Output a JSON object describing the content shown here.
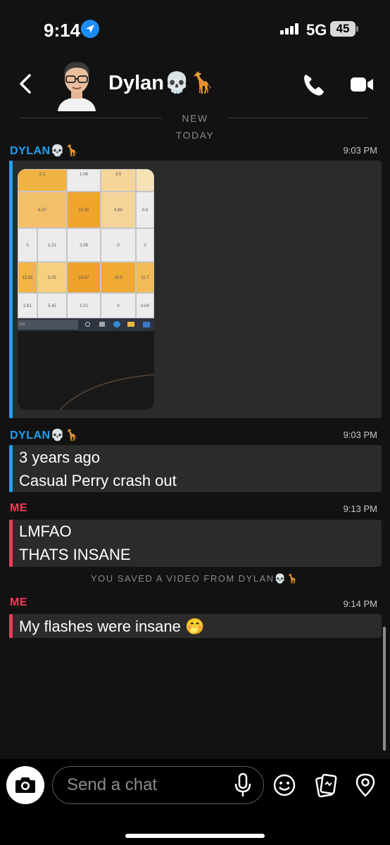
{
  "status_bar": {
    "time": "9:14",
    "network": "5G",
    "battery": "45"
  },
  "header": {
    "contact_name": "Dylan💀🦒"
  },
  "dividers": {
    "new_label": "NEW",
    "today_label": "TODAY"
  },
  "messages": [
    {
      "sender": "DYLAN💀🦒",
      "time": "9:03 PM",
      "type": "photo"
    },
    {
      "sender": "DYLAN💀🦒",
      "time": "9:03 PM",
      "lines": [
        "3 years ago",
        "Casual Perry crash out"
      ]
    },
    {
      "sender": "ME",
      "time": "9:13 PM",
      "lines": [
        "LMFAO",
        "THATS INSANE"
      ]
    },
    {
      "sender": "ME",
      "time": "9:14 PM",
      "lines": [
        "My flashes were insane 🤭"
      ]
    }
  ],
  "system_notice": "YOU SAVED A VIDEO FROM DYLAN💀🦒",
  "photo_sheet": {
    "rows": [
      [
        "5.2",
        "1.08",
        "3.5"
      ],
      [
        "6.37",
        "10.55",
        "4.86",
        "0.6"
      ],
      [
        "0",
        "1.21",
        "2.08",
        "0",
        "0"
      ],
      [
        "13.05",
        "5.05",
        "18.67",
        "16.5",
        "11.7"
      ],
      [
        "2.61",
        "5.42",
        "1.01",
        "0",
        "3.04"
      ]
    ],
    "taskbar_search": "rch"
  },
  "composer": {
    "placeholder": "Send a chat"
  },
  "colors": {
    "friend": "#1ea1f2",
    "me": "#f23c57",
    "bubble": "#2b2b2b",
    "background": "#121212"
  }
}
